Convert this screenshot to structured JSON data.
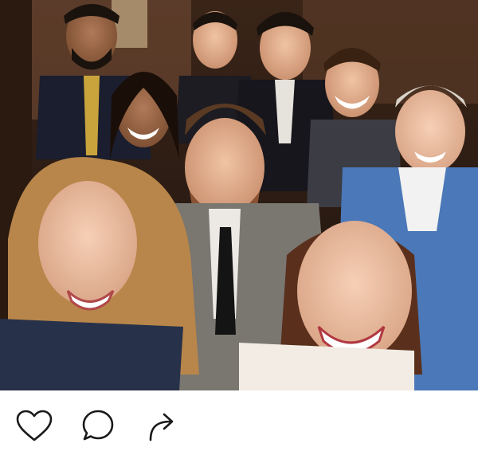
{
  "post": {
    "photo_alt": "",
    "colors": {
      "background_top": "#3a2418",
      "background_bottom": "#1e140e",
      "wall_panel": "#6a4630",
      "icon_stroke": "#1a1a1a"
    }
  },
  "actions": {
    "icons": [
      "heart-icon",
      "comment-icon",
      "share-icon"
    ]
  }
}
